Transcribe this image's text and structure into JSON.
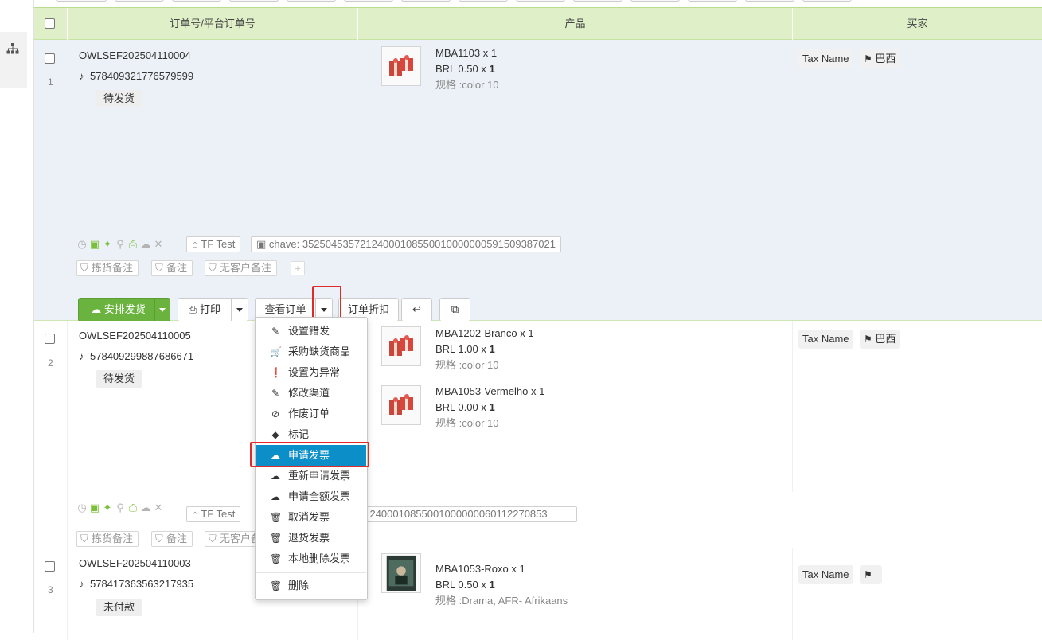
{
  "header": {
    "order_col": "订单号/平台订单号",
    "product_col": "产品",
    "buyer_col": "买家"
  },
  "orders": [
    {
      "index": "1",
      "order_no": "OWLSEF202504110004",
      "platform_no": "578409321776579599",
      "status": "待发货",
      "products": [
        {
          "name": "MBA1103 x 1",
          "price_prefix": "BRL 0.50 x ",
          "qty": "1",
          "spec": "规格 :color 10"
        }
      ],
      "buyer": {
        "tax": "Tax Name",
        "country": "巴西"
      },
      "shipping": "TF Test",
      "chave": "chave: 35250453572124000108550010000000591509387021",
      "notes": [
        "拣货备注",
        "备注",
        "无客户备注"
      ]
    },
    {
      "index": "2",
      "order_no": "OWLSEF202504110005",
      "platform_no": "578409299887686671",
      "status": "待发货",
      "products": [
        {
          "name": "MBA1202-Branco x 1",
          "price_prefix": "BRL 1.00 x ",
          "qty": "1",
          "spec": "规格 :color 10"
        },
        {
          "name": "MBA1053-Vermelho x 1",
          "price_prefix": "BRL 0.00 x ",
          "qty": "1",
          "spec": "规格 :color 10"
        }
      ],
      "buyer": {
        "tax": "Tax Name",
        "country": "巴西"
      },
      "shipping": "TF Test",
      "chave_visible": "212400010855001000000060112270853",
      "notes": [
        "拣货备注",
        "备注",
        "无客户备注"
      ]
    },
    {
      "index": "3",
      "order_no": "OWLSEF202504110003",
      "platform_no": "578417363563217935",
      "status": "未付款",
      "products": [
        {
          "name": "MBA1053-Roxo x 1",
          "price_prefix": "BRL 0.50 x ",
          "qty": "1",
          "spec": "规格 :Drama, AFR- Afrikaans"
        }
      ],
      "buyer": {
        "tax": "Tax Name"
      }
    }
  ],
  "actions": {
    "ship": "安排发货",
    "print": "打印",
    "view": "查看订单",
    "discount": "订单折扣"
  },
  "menu": {
    "items": [
      {
        "icon": "edit-icon",
        "label": "设置错发"
      },
      {
        "icon": "cart-icon",
        "label": "采购缺货商品"
      },
      {
        "icon": "exclamation-icon",
        "label": "设置为异常"
      },
      {
        "icon": "edit-icon",
        "label": "修改渠道"
      },
      {
        "icon": "ban-icon",
        "label": "作废订单"
      },
      {
        "icon": "tag-icon",
        "label": "标记"
      },
      {
        "icon": "cloud-upload-icon",
        "label": "申请发票"
      },
      {
        "icon": "cloud-upload-icon",
        "label": "重新申请发票"
      },
      {
        "icon": "cloud-upload-icon",
        "label": "申请全额发票"
      },
      {
        "icon": "trash-icon",
        "label": "取消发票"
      },
      {
        "icon": "trash-icon",
        "label": "退货发票"
      },
      {
        "icon": "trash-icon",
        "label": "本地删除发票"
      },
      {
        "icon": "trash-icon",
        "label": "删除"
      }
    ],
    "active_index": 6
  },
  "colors": {
    "header_bg": "#dff0c8",
    "selected_row_bg": "#ebf1f6",
    "ship_green": "#6ab33e",
    "menu_active": "#0c8fc9",
    "highlight_red": "#e12a2a"
  }
}
